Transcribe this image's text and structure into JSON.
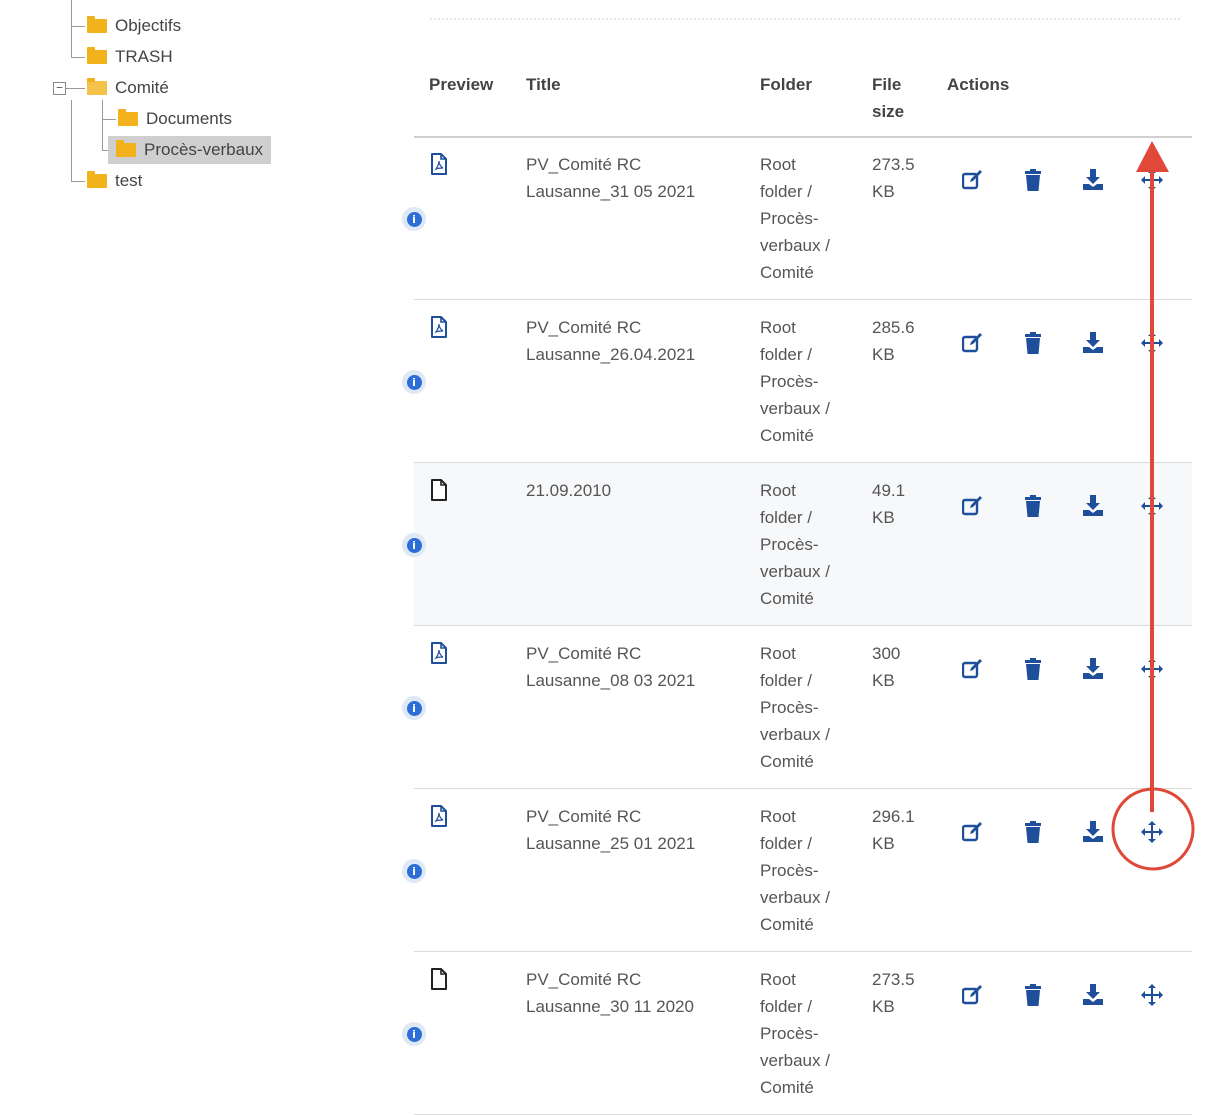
{
  "tree": {
    "items": [
      {
        "label": "Objectifs"
      },
      {
        "label": "TRASH"
      },
      {
        "label": "Comité"
      },
      {
        "label": "Documents"
      },
      {
        "label": "Procès-verbaux"
      },
      {
        "label": "test"
      }
    ],
    "collapse_symbol": "−"
  },
  "table": {
    "headers": {
      "preview": "Preview",
      "title": "Title",
      "folder": "Folder",
      "size_line1": "File",
      "size_line2": "size",
      "actions": "Actions"
    },
    "rows": [
      {
        "icon": "pdf-file-icon",
        "title_line1": "PV_Comité RC",
        "title_line2": "Lausanne_31 05 2021",
        "folder": [
          "Root",
          "folder /",
          "Procès-",
          "verbaux /",
          "Comité"
        ],
        "size_value": "273.5",
        "size_unit": "KB"
      },
      {
        "icon": "pdf-file-icon",
        "title_line1": "PV_Comité RC",
        "title_line2": "Lausanne_26.04.2021",
        "folder": [
          "Root",
          "folder /",
          "Procès-",
          "verbaux /",
          "Comité"
        ],
        "size_value": "285.6",
        "size_unit": "KB"
      },
      {
        "icon": "file-icon",
        "title_line1": "21.09.2010",
        "title_line2": "",
        "folder": [
          "Root",
          "folder /",
          "Procès-",
          "verbaux /",
          "Comité"
        ],
        "size_value": "49.1",
        "size_unit": "KB"
      },
      {
        "icon": "pdf-file-icon",
        "title_line1": "PV_Comité RC",
        "title_line2": "Lausanne_08 03 2021",
        "folder": [
          "Root",
          "folder /",
          "Procès-",
          "verbaux /",
          "Comité"
        ],
        "size_value": "300",
        "size_unit": "KB"
      },
      {
        "icon": "pdf-file-icon",
        "title_line1": "PV_Comité RC",
        "title_line2": "Lausanne_25 01 2021",
        "folder": [
          "Root",
          "folder /",
          "Procès-",
          "verbaux /",
          "Comité"
        ],
        "size_value": "296.1",
        "size_unit": "KB"
      },
      {
        "icon": "file-icon",
        "title_line1": "PV_Comité RC",
        "title_line2": "Lausanne_30 11 2020",
        "folder": [
          "Root",
          "folder /",
          "Procès-",
          "verbaux /",
          "Comité"
        ],
        "size_value": "273.5",
        "size_unit": "KB"
      }
    ],
    "info_symbol": "i"
  },
  "colors": {
    "action_blue": "#1f4e9a",
    "annotation_red": "#e0483a",
    "folder_yellow": "#f2b21c",
    "info_blue": "#2c6ed6"
  }
}
